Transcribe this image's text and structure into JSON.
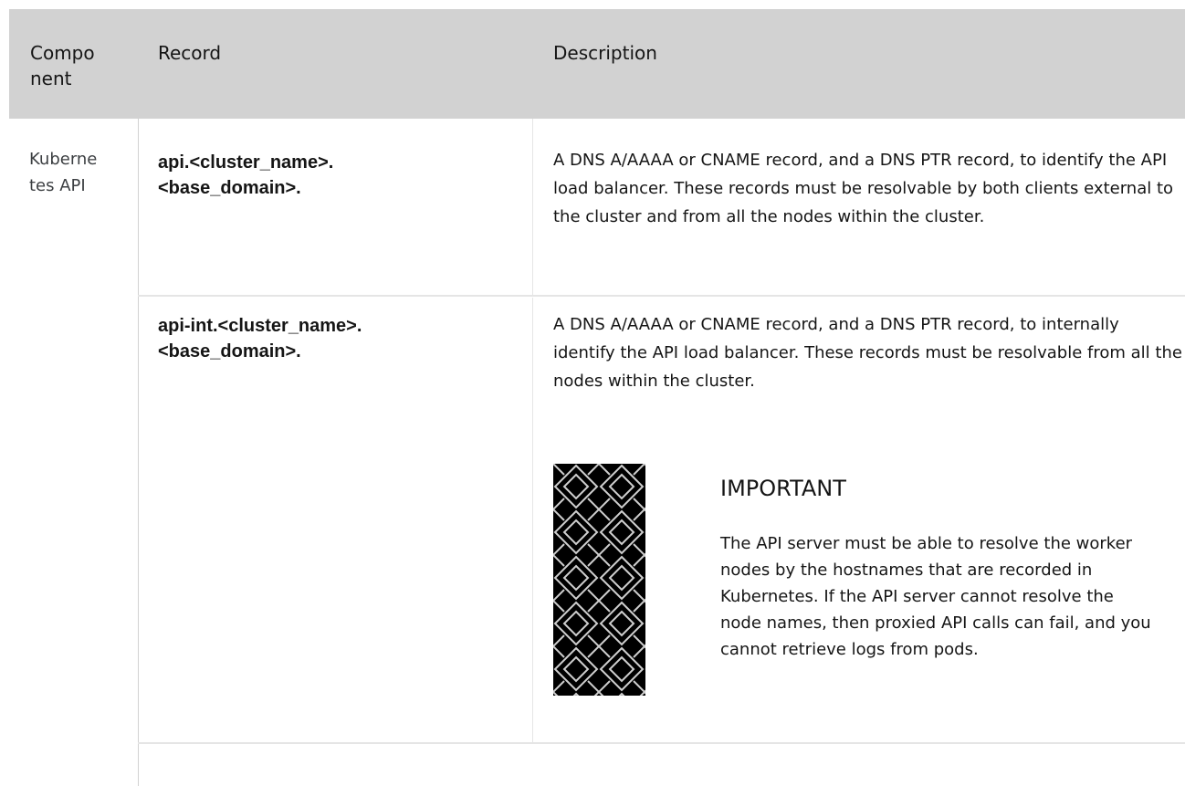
{
  "table": {
    "headers": {
      "component": "Compo\nnent",
      "record": "Record",
      "description": "Description"
    },
    "rows": [
      {
        "component": "Kuberne\ntes API",
        "record": "api.<cluster_name>.\n<base_domain>.",
        "description": "A DNS A/AAAA or CNAME record, and a DNS PTR record, to identify the API load balancer. These records must be resolvable by both clients external to the cluster and from all the nodes within the cluster."
      },
      {
        "record": "api-int.<cluster_name>.\n<base_domain>.",
        "description": "A DNS A/AAAA or CNAME record, and a DNS PTR record, to internally identify the API load balancer. These records must be resolvable from all the nodes within the cluster.",
        "admonition": {
          "icon": "important-pattern-icon",
          "title": "IMPORTANT",
          "body": "The API server must be able to resolve the worker nodes by the hostnames that are recorded in Kubernetes. If the API server cannot resolve the node names, then proxied API calls can fail, and you cannot retrieve logs from pods."
        }
      }
    ]
  }
}
